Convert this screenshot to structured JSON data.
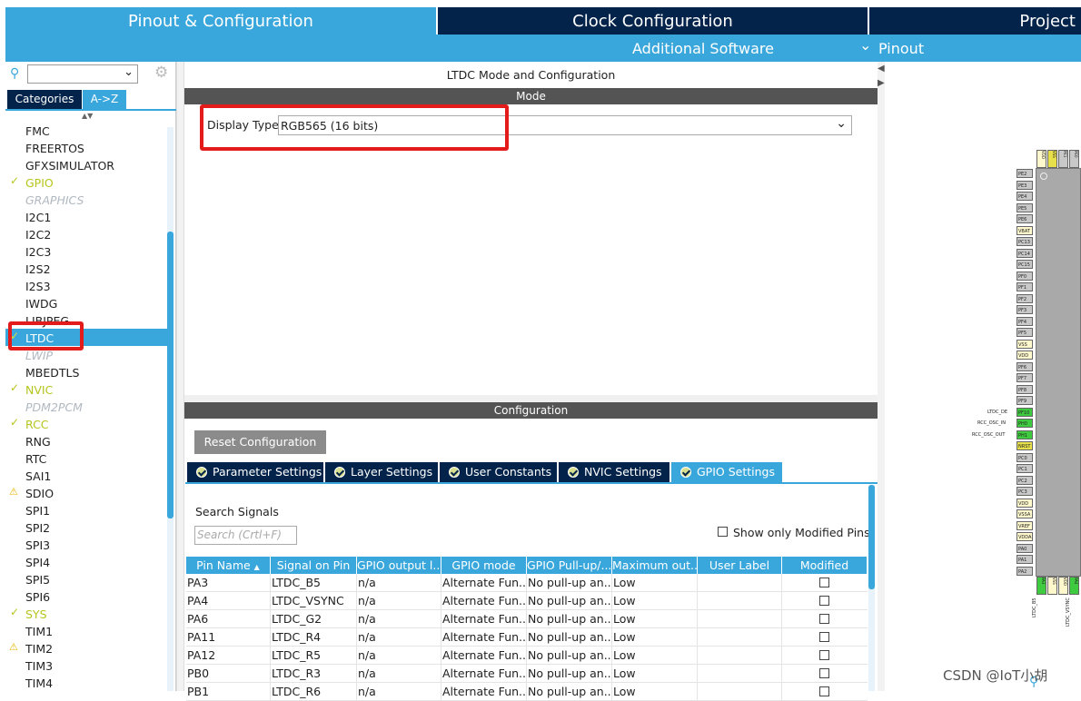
{
  "top_tabs": {
    "pinout": "Pinout & Configuration",
    "clock": "Clock Configuration",
    "project": "Project"
  },
  "subbar": {
    "additional": "Additional Software",
    "pinout": "Pinout"
  },
  "sidebar": {
    "tab_categories": "Categories",
    "tab_az": "A->Z",
    "items": [
      {
        "label": "FMC",
        "style": "n"
      },
      {
        "label": "FREERTOS",
        "style": "n"
      },
      {
        "label": "GFXSIMULATOR",
        "style": "n"
      },
      {
        "label": "GPIO",
        "style": "y"
      },
      {
        "label": "GRAPHICS",
        "style": "dis"
      },
      {
        "label": "I2C1",
        "style": "n"
      },
      {
        "label": "I2C2",
        "style": "n"
      },
      {
        "label": "I2C3",
        "style": "n"
      },
      {
        "label": "I2S2",
        "style": "n"
      },
      {
        "label": "I2S3",
        "style": "n"
      },
      {
        "label": "IWDG",
        "style": "n"
      },
      {
        "label": "LIBJPEG",
        "style": "n"
      },
      {
        "label": "LTDC",
        "style": "sel"
      },
      {
        "label": "LWIP",
        "style": "dis"
      },
      {
        "label": "MBEDTLS",
        "style": "n"
      },
      {
        "label": "NVIC",
        "style": "y"
      },
      {
        "label": "PDM2PCM",
        "style": "dis"
      },
      {
        "label": "RCC",
        "style": "y"
      },
      {
        "label": "RNG",
        "style": "n"
      },
      {
        "label": "RTC",
        "style": "n"
      },
      {
        "label": "SAI1",
        "style": "n"
      },
      {
        "label": "SDIO",
        "style": "n"
      },
      {
        "label": "SPI1",
        "style": "n"
      },
      {
        "label": "SPI2",
        "style": "n"
      },
      {
        "label": "SPI3",
        "style": "n"
      },
      {
        "label": "SPI4",
        "style": "n"
      },
      {
        "label": "SPI5",
        "style": "n"
      },
      {
        "label": "SPI6",
        "style": "n"
      },
      {
        "label": "SYS",
        "style": "y"
      },
      {
        "label": "TIM1",
        "style": "n"
      },
      {
        "label": "TIM2",
        "style": "n"
      },
      {
        "label": "TIM3",
        "style": "n"
      },
      {
        "label": "TIM4",
        "style": "n"
      }
    ]
  },
  "main": {
    "title": "LTDC Mode and Configuration",
    "mode_header": "Mode",
    "display_type_label": "Display Type",
    "display_type_value": "RGB565 (16 bits)",
    "config_header": "Configuration",
    "reset_button": "Reset Configuration",
    "tabs": [
      "Parameter Settings",
      "Layer Settings",
      "User Constants",
      "NVIC Settings",
      "GPIO Settings"
    ],
    "search_label": "Search Signals",
    "search_placeholder": "Search (Crtl+F)",
    "show_modified": "Show only Modified Pins",
    "columns": [
      "Pin Name",
      "Signal on Pin",
      "GPIO output l...",
      "GPIO mode",
      "GPIO Pull-up/...",
      "Maximum out...",
      "User Label",
      "Modified"
    ],
    "rows": [
      [
        "PA3",
        "LTDC_B5",
        "n/a",
        "Alternate Fun...",
        "No pull-up an...",
        "Low",
        ""
      ],
      [
        "PA4",
        "LTDC_VSYNC",
        "n/a",
        "Alternate Fun...",
        "No pull-up an...",
        "Low",
        ""
      ],
      [
        "PA6",
        "LTDC_G2",
        "n/a",
        "Alternate Fun...",
        "No pull-up an...",
        "Low",
        ""
      ],
      [
        "PA11",
        "LTDC_R4",
        "n/a",
        "Alternate Fun...",
        "No pull-up an...",
        "Low",
        ""
      ],
      [
        "PA12",
        "LTDC_R5",
        "n/a",
        "Alternate Fun...",
        "No pull-up an...",
        "Low",
        ""
      ],
      [
        "PB0",
        "LTDC_R3",
        "n/a",
        "Alternate Fun...",
        "No pull-up an...",
        "Low",
        ""
      ],
      [
        "PB1",
        "LTDC_R6",
        "n/a",
        "Alternate Fun...",
        "No pull-up an...",
        "Low",
        ""
      ]
    ]
  },
  "chip": {
    "pins_left": [
      "PE2",
      "PE3",
      "PE4",
      "PE5",
      "PE6",
      "VBAT",
      "PC13",
      "PC14",
      "PC15",
      "PF0",
      "PF1",
      "PF2",
      "PF3",
      "PF4",
      "PF5",
      "VSS",
      "VDD",
      "PF6",
      "PF7",
      "PF8",
      "PF9",
      "PF10",
      "PH0",
      "PH1",
      "NRST",
      "PC0",
      "PC1",
      "PC2",
      "PC3",
      "VDD",
      "VSSA",
      "VREF",
      "VDDA",
      "PA0",
      "PA1",
      "PA2"
    ],
    "pin_labels": {
      "ltdc_de": "LTDC_DE",
      "osc_in": "RCC_OSC_IN",
      "osc_out": "RCC_OSC_OUT",
      "bottom1": "LTDC_B5",
      "bottom2": "LTDC_VSYNC"
    },
    "top_pins": [
      "VDD",
      "VSS",
      "PE1",
      "PE0"
    ],
    "bottom_pins": [
      "PA3",
      "VSS",
      "VDD",
      "PA4"
    ]
  },
  "watermark": "CSDN @IoT小胡"
}
